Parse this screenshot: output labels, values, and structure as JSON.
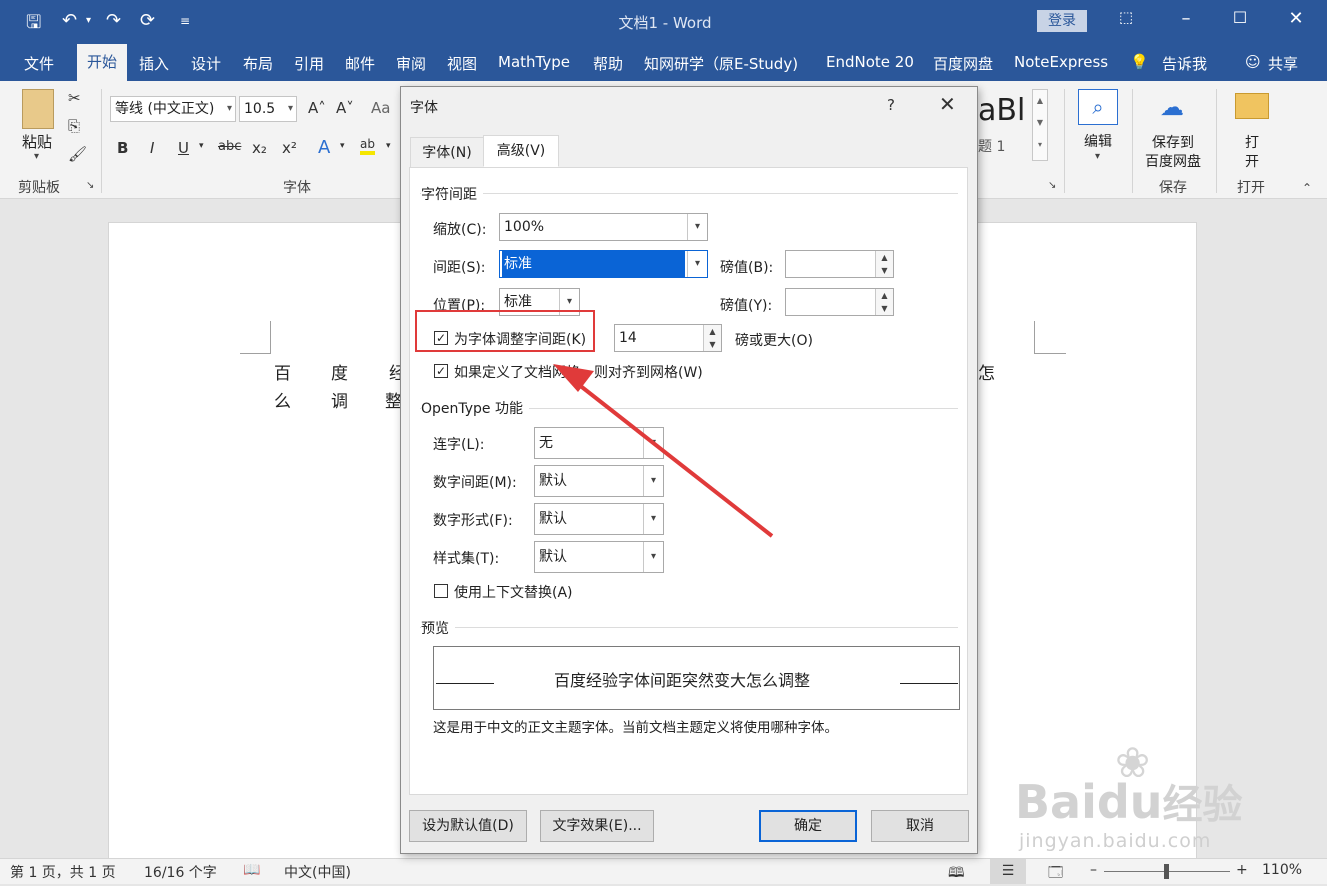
{
  "window": {
    "doc_title": "文档1 - Word",
    "login_label": "登录"
  },
  "menu": {
    "tabs": [
      "文件",
      "开始",
      "插入",
      "设计",
      "布局",
      "引用",
      "邮件",
      "审阅",
      "视图",
      "MathType",
      "帮助",
      "知网研学（原E-Study)",
      "EndNote 20",
      "百度网盘",
      "NoteExpress",
      "告诉我",
      "共享"
    ]
  },
  "ribbon": {
    "paste_label": "粘贴",
    "clipboard_label": "剪贴板",
    "font_name": "等线 (中文正文)",
    "font_size": "10.5",
    "font_group_label": "字体",
    "style_preview": "aBl",
    "style_name": "题 1",
    "edit_label": "编辑",
    "save_to_cloud_line1": "保存到",
    "save_to_cloud_line2": "百度网盘",
    "save_group_label": "保存",
    "open_line1": "打",
    "open_line2": "开",
    "open_group_label": "打开"
  },
  "document": {
    "line1_left": [
      "百",
      "度",
      "经"
    ],
    "line1_right": "怎",
    "line2_left": [
      "么",
      "调",
      "整"
    ]
  },
  "statusbar": {
    "page_info": "第 1 页，共 1 页",
    "word_count": "16/16 个字",
    "language": "中文(中国)",
    "zoom": "110%"
  },
  "dialog": {
    "title": "字体",
    "help": "?",
    "tabs": [
      "字体(N)",
      "高级(V)"
    ],
    "spacing_group": "字符间距",
    "scale_label": "缩放(C):",
    "scale_value": "100%",
    "spacing_label": "间距(S):",
    "spacing_value": "标准",
    "spacing_by_label": "磅值(B):",
    "position_label": "位置(P):",
    "position_value": "标准",
    "position_by_label": "磅值(Y):",
    "kerning_label": "为字体调整字间距(K)",
    "kerning_checked": true,
    "kerning_value": "14",
    "kerning_suffix": "磅或更大(O)",
    "grid_label": "如果定义了文档网格，则对齐到网格(W)",
    "grid_checked": true,
    "opentype_group": "OpenType 功能",
    "ligature_label": "连字(L):",
    "ligature_value": "无",
    "num_spacing_label": "数字间距(M):",
    "num_spacing_value": "默认",
    "num_form_label": "数字形式(F):",
    "num_form_value": "默认",
    "style_set_label": "样式集(T):",
    "style_set_value": "默认",
    "contextual_label": "使用上下文替换(A)",
    "contextual_checked": false,
    "preview_group": "预览",
    "preview_text": "百度经验字体间距突然变大怎么调整",
    "preview_note": "这是用于中文的正文主题字体。当前文档主题定义将使用哪种字体。",
    "set_default_label": "设为默认值(D)",
    "text_effects_label": "文字效果(E)...",
    "ok_label": "确定",
    "cancel_label": "取消"
  },
  "annotation": {
    "highlight_color": "#e03a3a"
  },
  "watermark": {
    "brand": "Bai",
    "brand_du": "du",
    "brand_cn": "经验",
    "url": "jingyan.baidu.com"
  }
}
